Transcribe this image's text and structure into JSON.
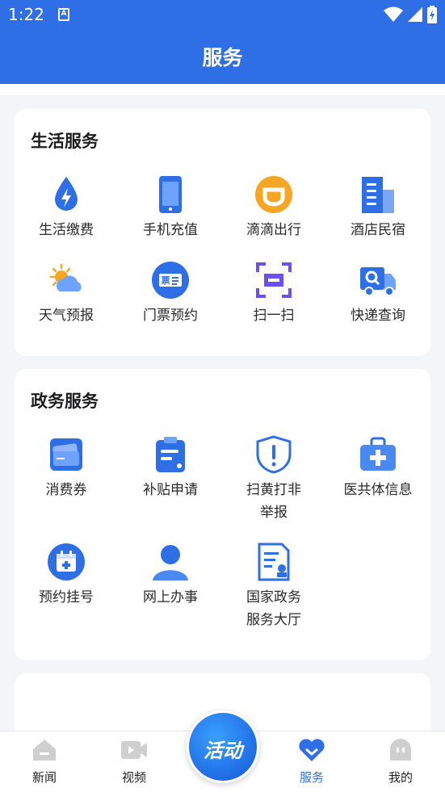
{
  "status": {
    "time": "1:22",
    "sim": "A"
  },
  "header": {
    "title": "服务"
  },
  "life": {
    "title": "生活服务",
    "items": [
      {
        "label": "生活缴费",
        "icon": "water-drop-icon"
      },
      {
        "label": "手机充值",
        "icon": "phone-icon"
      },
      {
        "label": "滴滴出行",
        "icon": "didi-icon"
      },
      {
        "label": "酒店民宿",
        "icon": "hotel-building-icon"
      },
      {
        "label": "天气预报",
        "icon": "weather-icon"
      },
      {
        "label": "门票预约",
        "icon": "ticket-icon"
      },
      {
        "label": "扫一扫",
        "icon": "scan-icon"
      },
      {
        "label": "快递查询",
        "icon": "delivery-truck-icon"
      }
    ]
  },
  "gov": {
    "title": "政务服务",
    "items": [
      {
        "label": "消费券",
        "icon": "coupon-icon"
      },
      {
        "label": "补贴申请",
        "icon": "clipboard-icon"
      },
      {
        "label": "扫黄打非\n举报",
        "icon": "shield-alert-icon"
      },
      {
        "label": "医共体信息",
        "icon": "medical-kit-icon"
      },
      {
        "label": "预约挂号",
        "icon": "calendar-plus-icon"
      },
      {
        "label": "网上办事",
        "icon": "person-icon"
      },
      {
        "label": "国家政务\n服务大厅",
        "icon": "document-seal-icon"
      }
    ]
  },
  "tabbar": {
    "items": [
      {
        "label": "新闻",
        "icon": "home-icon"
      },
      {
        "label": "视频",
        "icon": "video-icon"
      },
      {
        "label": "服务",
        "icon": "heart-icon",
        "active": true
      },
      {
        "label": "我的",
        "icon": "profile-icon"
      }
    ],
    "center_label": "活动"
  },
  "colors": {
    "primary": "#2f6fe6",
    "tab_inactive": "#c8c8c8"
  }
}
